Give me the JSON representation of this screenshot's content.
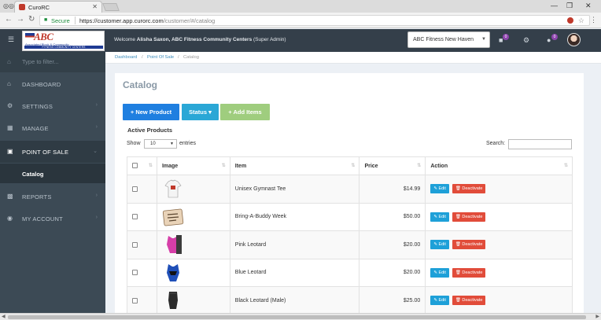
{
  "browser": {
    "tab_title": "CuroRC",
    "secure_label": "Secure",
    "url_host": "https://customer.app.curorc.com",
    "url_path": "/customer/#/catalog"
  },
  "header": {
    "welcome_prefix": "Welcome",
    "user_line": "Alisha Saxon, ABC Fitness Community Centers",
    "role": "(Super Admin)",
    "location": "ABC Fitness New Haven",
    "notifications_count": "0",
    "messages_count": "0",
    "logo_text": "ABC",
    "logo_sub": "Associated Block & Community",
    "logo_bar": "FITNESS COMMUNITY CENTERS"
  },
  "sidebar": {
    "filter_placeholder": "Type to filter...",
    "items": [
      {
        "label": "DASHBOARD",
        "icon": "home-icon"
      },
      {
        "label": "SETTINGS",
        "icon": "gear-icon"
      },
      {
        "label": "MANAGE",
        "icon": "grid-icon"
      },
      {
        "label": "POINT OF SALE",
        "icon": "cart-icon"
      },
      {
        "label": "REPORTS",
        "icon": "bar-chart-icon"
      },
      {
        "label": "MY ACCOUNT",
        "icon": "user-circle-icon"
      }
    ],
    "active_sub": "Catalog"
  },
  "breadcrumb": {
    "items": [
      "Dashboard",
      "Point Of Sale",
      "Catalog"
    ]
  },
  "main": {
    "title": "Catalog",
    "buttons": {
      "new_product": "New Product",
      "status": "Status",
      "add_items": "Add Items"
    },
    "section": "Active Products",
    "show_label": "Show",
    "entries_value": "10",
    "entries_label": "entries",
    "search_label": "Search:",
    "columns": [
      "Image",
      "Item",
      "Price",
      "Action"
    ],
    "rows": [
      {
        "item": "Unisex Gymnast Tee",
        "price": "$14.99"
      },
      {
        "item": "Bring-A-Buddy Week",
        "price": "$50.00"
      },
      {
        "item": "Pink Leotard",
        "price": "$20.00"
      },
      {
        "item": "Blue Leotard",
        "price": "$20.00"
      },
      {
        "item": "Black Leotard (Male)",
        "price": "$25.00"
      }
    ],
    "edit_label": "Edit",
    "deactivate_label": "Deactivate"
  },
  "colors": {
    "sidebar_bg": "#3c4a55",
    "header_bg": "#343f4a",
    "primary_blue": "#1f7fe0",
    "info_blue": "#2aa7d6",
    "success_green": "#9fcd7e",
    "danger_red": "#e14c3a"
  }
}
